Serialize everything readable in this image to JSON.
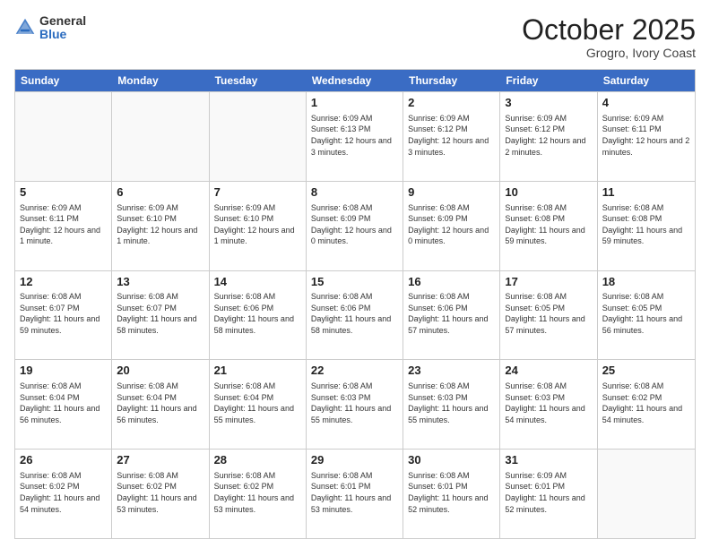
{
  "header": {
    "logo_general": "General",
    "logo_blue": "Blue",
    "month": "October 2025",
    "location": "Grogro, Ivory Coast"
  },
  "weekdays": [
    "Sunday",
    "Monday",
    "Tuesday",
    "Wednesday",
    "Thursday",
    "Friday",
    "Saturday"
  ],
  "rows": [
    [
      {
        "num": "",
        "info": ""
      },
      {
        "num": "",
        "info": ""
      },
      {
        "num": "",
        "info": ""
      },
      {
        "num": "1",
        "info": "Sunrise: 6:09 AM\nSunset: 6:13 PM\nDaylight: 12 hours and 3 minutes."
      },
      {
        "num": "2",
        "info": "Sunrise: 6:09 AM\nSunset: 6:12 PM\nDaylight: 12 hours and 3 minutes."
      },
      {
        "num": "3",
        "info": "Sunrise: 6:09 AM\nSunset: 6:12 PM\nDaylight: 12 hours and 2 minutes."
      },
      {
        "num": "4",
        "info": "Sunrise: 6:09 AM\nSunset: 6:11 PM\nDaylight: 12 hours and 2 minutes."
      }
    ],
    [
      {
        "num": "5",
        "info": "Sunrise: 6:09 AM\nSunset: 6:11 PM\nDaylight: 12 hours and 1 minute."
      },
      {
        "num": "6",
        "info": "Sunrise: 6:09 AM\nSunset: 6:10 PM\nDaylight: 12 hours and 1 minute."
      },
      {
        "num": "7",
        "info": "Sunrise: 6:09 AM\nSunset: 6:10 PM\nDaylight: 12 hours and 1 minute."
      },
      {
        "num": "8",
        "info": "Sunrise: 6:08 AM\nSunset: 6:09 PM\nDaylight: 12 hours and 0 minutes."
      },
      {
        "num": "9",
        "info": "Sunrise: 6:08 AM\nSunset: 6:09 PM\nDaylight: 12 hours and 0 minutes."
      },
      {
        "num": "10",
        "info": "Sunrise: 6:08 AM\nSunset: 6:08 PM\nDaylight: 11 hours and 59 minutes."
      },
      {
        "num": "11",
        "info": "Sunrise: 6:08 AM\nSunset: 6:08 PM\nDaylight: 11 hours and 59 minutes."
      }
    ],
    [
      {
        "num": "12",
        "info": "Sunrise: 6:08 AM\nSunset: 6:07 PM\nDaylight: 11 hours and 59 minutes."
      },
      {
        "num": "13",
        "info": "Sunrise: 6:08 AM\nSunset: 6:07 PM\nDaylight: 11 hours and 58 minutes."
      },
      {
        "num": "14",
        "info": "Sunrise: 6:08 AM\nSunset: 6:06 PM\nDaylight: 11 hours and 58 minutes."
      },
      {
        "num": "15",
        "info": "Sunrise: 6:08 AM\nSunset: 6:06 PM\nDaylight: 11 hours and 58 minutes."
      },
      {
        "num": "16",
        "info": "Sunrise: 6:08 AM\nSunset: 6:06 PM\nDaylight: 11 hours and 57 minutes."
      },
      {
        "num": "17",
        "info": "Sunrise: 6:08 AM\nSunset: 6:05 PM\nDaylight: 11 hours and 57 minutes."
      },
      {
        "num": "18",
        "info": "Sunrise: 6:08 AM\nSunset: 6:05 PM\nDaylight: 11 hours and 56 minutes."
      }
    ],
    [
      {
        "num": "19",
        "info": "Sunrise: 6:08 AM\nSunset: 6:04 PM\nDaylight: 11 hours and 56 minutes."
      },
      {
        "num": "20",
        "info": "Sunrise: 6:08 AM\nSunset: 6:04 PM\nDaylight: 11 hours and 56 minutes."
      },
      {
        "num": "21",
        "info": "Sunrise: 6:08 AM\nSunset: 6:04 PM\nDaylight: 11 hours and 55 minutes."
      },
      {
        "num": "22",
        "info": "Sunrise: 6:08 AM\nSunset: 6:03 PM\nDaylight: 11 hours and 55 minutes."
      },
      {
        "num": "23",
        "info": "Sunrise: 6:08 AM\nSunset: 6:03 PM\nDaylight: 11 hours and 55 minutes."
      },
      {
        "num": "24",
        "info": "Sunrise: 6:08 AM\nSunset: 6:03 PM\nDaylight: 11 hours and 54 minutes."
      },
      {
        "num": "25",
        "info": "Sunrise: 6:08 AM\nSunset: 6:02 PM\nDaylight: 11 hours and 54 minutes."
      }
    ],
    [
      {
        "num": "26",
        "info": "Sunrise: 6:08 AM\nSunset: 6:02 PM\nDaylight: 11 hours and 54 minutes."
      },
      {
        "num": "27",
        "info": "Sunrise: 6:08 AM\nSunset: 6:02 PM\nDaylight: 11 hours and 53 minutes."
      },
      {
        "num": "28",
        "info": "Sunrise: 6:08 AM\nSunset: 6:02 PM\nDaylight: 11 hours and 53 minutes."
      },
      {
        "num": "29",
        "info": "Sunrise: 6:08 AM\nSunset: 6:01 PM\nDaylight: 11 hours and 53 minutes."
      },
      {
        "num": "30",
        "info": "Sunrise: 6:08 AM\nSunset: 6:01 PM\nDaylight: 11 hours and 52 minutes."
      },
      {
        "num": "31",
        "info": "Sunrise: 6:09 AM\nSunset: 6:01 PM\nDaylight: 11 hours and 52 minutes."
      },
      {
        "num": "",
        "info": ""
      }
    ]
  ]
}
